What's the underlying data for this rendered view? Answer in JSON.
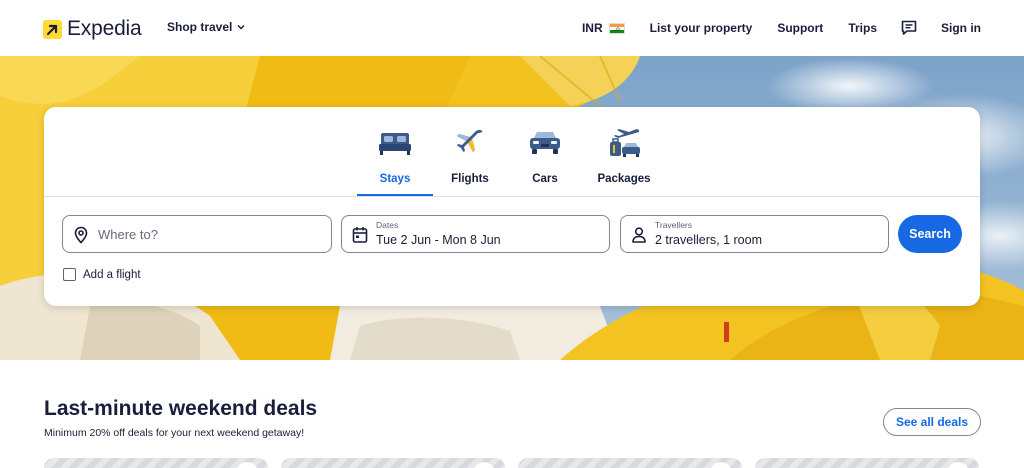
{
  "header": {
    "logo_text": "Expedia",
    "shop_travel_label": "Shop travel",
    "currency_label": "INR",
    "list_property_label": "List your property",
    "support_label": "Support",
    "trips_label": "Trips",
    "sign_in_label": "Sign in"
  },
  "search": {
    "tabs": [
      {
        "label": "Stays",
        "icon": "bed-icon",
        "active": true
      },
      {
        "label": "Flights",
        "icon": "airplane-icon",
        "active": false
      },
      {
        "label": "Cars",
        "icon": "car-icon",
        "active": false
      },
      {
        "label": "Packages",
        "icon": "packages-icon",
        "active": false
      }
    ],
    "destination_placeholder": "Where to?",
    "dates_label": "Dates",
    "dates_value": "Tue 2 Jun - Mon 8 Jun",
    "travellers_label": "Travellers",
    "travellers_value": "2 travellers, 1 room",
    "search_button_label": "Search",
    "add_flight_label": "Add a flight",
    "add_flight_checked": false
  },
  "deals": {
    "title": "Last-minute weekend deals",
    "subtitle": "Minimum 20% off deals for your next weekend getaway!",
    "see_all_label": "See all deals"
  },
  "colors": {
    "brand_blue": "#1668e3",
    "brand_yellow": "#fddb32",
    "text_dark": "#191e3b"
  }
}
